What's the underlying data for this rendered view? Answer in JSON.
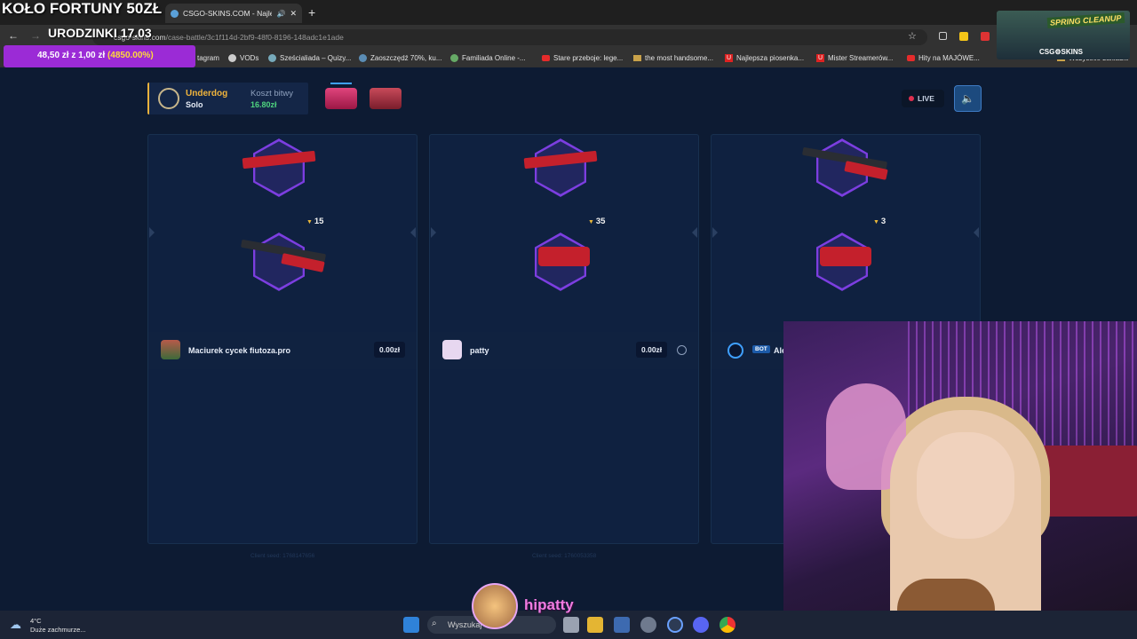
{
  "overlay": {
    "title": "KOŁO FORTUNY 50ZŁ",
    "birthday": "URODZINKI 17.03",
    "goal_prefix": "48,50 zł z 1,00 zł",
    "goal_pct": "(4850.00%)",
    "streamer_name": "hipatty",
    "promo_line1": "SPRING CLEANUP",
    "promo_line2": "CSG⚙SKINS"
  },
  "browser": {
    "tab_title": "CSGO-SKINS.COM - Najlep",
    "url_host": "csgo-skins.com",
    "url_path": "/case-battle/3c1f114d-2bf9-48f0-8196-148adc1e1ade",
    "new_tab_icon": "plus-icon",
    "bookmarks": [
      {
        "label": "tagram",
        "icon": "instagram-icon"
      },
      {
        "label": "VODs",
        "icon": "globe-icon"
      },
      {
        "label": "Sześcialiada – Quizy...",
        "icon": "globe-icon"
      },
      {
        "label": "Zaoszczędź 70%, ku...",
        "icon": "steam-icon"
      },
      {
        "label": "Familiada Online -...",
        "icon": "globe-icon"
      },
      {
        "label": "Stare przeboje: lege...",
        "icon": "youtube-icon"
      },
      {
        "label": "the most handsome...",
        "icon": "folder-icon"
      },
      {
        "label": "Najlepsza piosenka...",
        "icon": "u-icon"
      },
      {
        "label": "Mister Streamerów...",
        "icon": "u-icon"
      },
      {
        "label": "Hity na MAJÓWE...",
        "icon": "youtube-icon"
      },
      {
        "label": "Wszystkie zakładki",
        "icon": "folder-icon"
      }
    ]
  },
  "battle": {
    "mode": "Underdog",
    "mode_sub": "Solo",
    "cost_label": "Koszt bitwy",
    "cost_value": "16.80zł",
    "live_label": "LIVE",
    "accent": "#7c3ee0"
  },
  "players": [
    {
      "name": "Maciurek cycek fiutoza.pro",
      "value": "0.00zł",
      "top_price": "15",
      "seed": "Client seed: 1768147656",
      "badge": ""
    },
    {
      "name": "patty",
      "value": "0.00zł",
      "top_price": "35",
      "seed": "Client seed: 1760053358",
      "badge": ""
    },
    {
      "name": "Ale",
      "value": "",
      "top_price": "3",
      "seed": "",
      "badge": "BOT"
    }
  ],
  "taskbar": {
    "temp": "4°C",
    "weather": "Duże zachmurze...",
    "search_placeholder": "Wyszukaj"
  }
}
